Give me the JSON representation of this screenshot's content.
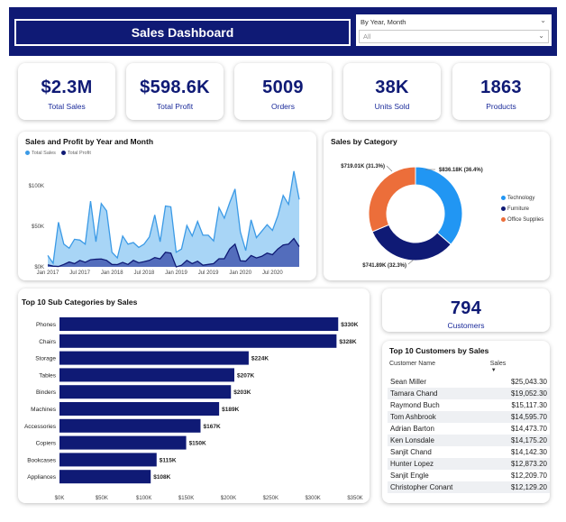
{
  "header": {
    "title": "Sales Dashboard",
    "filter_label": "By Year, Month",
    "filter_value": "All"
  },
  "kpis": [
    {
      "value": "$2.3M",
      "label": "Total Sales"
    },
    {
      "value": "$598.6K",
      "label": "Total Profit"
    },
    {
      "value": "5009",
      "label": "Orders"
    },
    {
      "value": "38K",
      "label": "Units Sold"
    },
    {
      "value": "1863",
      "label": "Products"
    }
  ],
  "customers_kpi": {
    "value": "794",
    "label": "Customers"
  },
  "line_card": {
    "title": "Sales and Profit by Year and Month",
    "legend": [
      "Total Sales",
      "Total Profit"
    ]
  },
  "pie_card": {
    "title": "Sales by Category",
    "legend": [
      "Technology",
      "Furniture",
      "Office Supplies"
    ]
  },
  "bar_card": {
    "title": "Top 10 Sub Categories by Sales"
  },
  "customers_table": {
    "title": "Top 10 Customers by Sales",
    "columns": [
      "Customer Name",
      "Sales"
    ],
    "rows": [
      [
        "Sean Miller",
        "$25,043.30"
      ],
      [
        "Tamara Chand",
        "$19,052.30"
      ],
      [
        "Raymond Buch",
        "$15,117.30"
      ],
      [
        "Tom Ashbrook",
        "$14,595.70"
      ],
      [
        "Adrian Barton",
        "$14,473.70"
      ],
      [
        "Ken Lonsdale",
        "$14,175.20"
      ],
      [
        "Sanjit Chand",
        "$14,142.30"
      ],
      [
        "Hunter Lopez",
        "$12,873.20"
      ],
      [
        "Sanjit Engle",
        "$12,209.70"
      ],
      [
        "Christopher Conant",
        "$12,129.20"
      ]
    ]
  },
  "colors": {
    "navy": "#0f1a75",
    "sales_area": "#9fd0f5",
    "sales_line": "#3b9ae6",
    "profit_area": "#4e67b8",
    "profit_line": "#0f1a75",
    "technology": "#2196f3",
    "furniture": "#0f1a75",
    "office_supplies": "#ec6e3a"
  },
  "chart_data": [
    {
      "type": "area",
      "title": "Sales and Profit by Year and Month",
      "x": [
        "Jan 2017",
        "Feb 2017",
        "Mar 2017",
        "Apr 2017",
        "May 2017",
        "Jun 2017",
        "Jul 2017",
        "Aug 2017",
        "Sep 2017",
        "Oct 2017",
        "Nov 2017",
        "Dec 2017",
        "Jan 2018",
        "Feb 2018",
        "Mar 2018",
        "Apr 2018",
        "May 2018",
        "Jun 2018",
        "Jul 2018",
        "Aug 2018",
        "Sep 2018",
        "Oct 2018",
        "Nov 2018",
        "Dec 2018",
        "Jan 2019",
        "Feb 2019",
        "Mar 2019",
        "Apr 2019",
        "May 2019",
        "Jun 2019",
        "Jul 2019",
        "Aug 2019",
        "Sep 2019",
        "Oct 2019",
        "Nov 2019",
        "Dec 2019",
        "Jan 2020",
        "Feb 2020",
        "Mar 2020",
        "Apr 2020",
        "May 2020",
        "Jun 2020",
        "Jul 2020",
        "Aug 2020",
        "Sep 2020",
        "Oct 2020",
        "Nov 2020",
        "Dec 2020"
      ],
      "x_ticks": [
        "Jan 2017",
        "Jul 2017",
        "Jan 2018",
        "Jul 2018",
        "Jan 2019",
        "Jul 2019",
        "Jan 2020",
        "Jul 2020"
      ],
      "y_ticks": [
        "$0K",
        "$50K",
        "$100K"
      ],
      "ylim": [
        0,
        120000
      ],
      "series": [
        {
          "name": "Total Sales",
          "values": [
            14000,
            4500,
            55000,
            28000,
            23000,
            34000,
            33000,
            28000,
            81000,
            31000,
            78000,
            69000,
            18000,
            11000,
            38000,
            28000,
            30000,
            24000,
            28000,
            37000,
            64000,
            31000,
            75000,
            74000,
            18000,
            22000,
            51000,
            38000,
            56000,
            39000,
            39000,
            32000,
            73000,
            60000,
            79000,
            96000,
            43000,
            20000,
            58000,
            36000,
            44000,
            52000,
            45000,
            63000,
            88000,
            77000,
            118000,
            83000
          ]
        },
        {
          "name": "Total Profit",
          "values": [
            2500,
            900,
            500,
            3000,
            6000,
            4000,
            8000,
            5600,
            8800,
            9400,
            9700,
            8000,
            3000,
            2800,
            5500,
            3000,
            8000,
            5000,
            6400,
            8000,
            11500,
            9900,
            18000,
            17000,
            -3000,
            2000,
            8000,
            4000,
            7000,
            2000,
            3000,
            4000,
            10000,
            10000,
            22000,
            28000,
            7500,
            7000,
            14000,
            11000,
            13000,
            17000,
            15000,
            22000,
            27000,
            28000,
            35000,
            25000
          ]
        }
      ]
    },
    {
      "type": "pie",
      "title": "Sales by Category",
      "categories": [
        "Technology",
        "Furniture",
        "Office Supplies"
      ],
      "values": [
        836180,
        741890,
        719010
      ],
      "labels": [
        "$836.18K (36.4%)",
        "$741.89K (32.3%)",
        "$719.01K (31.3%)"
      ]
    },
    {
      "type": "bar",
      "title": "Top 10 Sub Categories by Sales",
      "categories": [
        "Phones",
        "Chairs",
        "Storage",
        "Tables",
        "Binders",
        "Machines",
        "Accessories",
        "Copiers",
        "Bookcases",
        "Appliances"
      ],
      "values": [
        330000,
        328000,
        224000,
        207000,
        203000,
        189000,
        167000,
        150000,
        115000,
        108000
      ],
      "labels": [
        "$330K",
        "$328K",
        "$224K",
        "$207K",
        "$203K",
        "$189K",
        "$167K",
        "$150K",
        "$115K",
        "$108K"
      ],
      "x_ticks": [
        "$0K",
        "$50K",
        "$100K",
        "$150K",
        "$200K",
        "$250K",
        "$300K",
        "$350K"
      ],
      "xlim": [
        0,
        350000
      ]
    }
  ]
}
